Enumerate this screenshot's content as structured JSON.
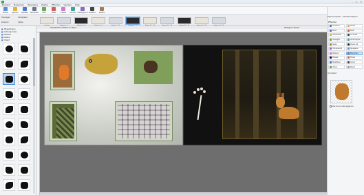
{
  "window": {
    "title": "",
    "controls": [
      "–",
      "□",
      "✕"
    ]
  },
  "menu": [
    "Bestand",
    "Bewerken",
    "Weergave",
    "Pagina",
    "Effecten",
    "Venster",
    "Help"
  ],
  "ribbon": {
    "buttons": [
      {
        "label": "Nieuw",
        "icon": "new-doc-icon",
        "color": "#5b8fd6"
      },
      {
        "label": "Openen",
        "icon": "folder-icon",
        "color": "#e3b341"
      },
      {
        "label": "Opslaan",
        "icon": "save-icon",
        "color": "#4a79c9"
      },
      {
        "label": "Afdrukken",
        "icon": "printer-icon",
        "color": "#6b7683"
      },
      {
        "label": "Foto",
        "icon": "photo-icon",
        "color": "#6aa84f"
      },
      {
        "label": "Tekst",
        "icon": "text-icon",
        "color": "#d05b5b"
      },
      {
        "label": "Clipart",
        "icon": "clipart-icon",
        "color": "#cb7bd2"
      },
      {
        "label": "Vormen",
        "icon": "shapes-icon",
        "color": "#3aa6a0"
      },
      {
        "label": "Achtergrond",
        "icon": "background-icon",
        "color": "#8a6bc9"
      },
      {
        "label": "Maskers",
        "icon": "mask-icon",
        "color": "#444"
      },
      {
        "label": "Kaders",
        "icon": "frame-icon",
        "color": "#a67c52"
      }
    ],
    "right_label": "Album opslaan",
    "right_icon": "export-icon"
  },
  "page_strip": {
    "nav": [
      "Toevoegen",
      "Verwijderen",
      "Kopiëren",
      "Opties"
    ],
    "pages": [
      {
        "label": "Omslag"
      },
      {
        "label": "Pagina 1 - 2"
      },
      {
        "label": "Pagina 3 - 4"
      },
      {
        "label": "Pagina 5 - 6"
      },
      {
        "label": "Pagina 7 - 8"
      },
      {
        "label": "Pagina 9 - 10",
        "selected": true
      },
      {
        "label": "Pagina 11 - 12"
      },
      {
        "label": "Pagina 13 - 14"
      },
      {
        "label": "Pagina 15 - 16"
      },
      {
        "label": "Pagina 17 - 18"
      },
      {
        "label": "Pagina 19 - 20"
      }
    ]
  },
  "left_panel": {
    "tabs": [
      {
        "label": "Afbeeldingen",
        "icon": "image-icon"
      },
      {
        "label": "Achtergronden",
        "icon": "background-icon"
      },
      {
        "label": "Maskers",
        "icon": "mask-icon"
      },
      {
        "label": "Kaders",
        "icon": "frame-icon"
      },
      {
        "label": "Clipart",
        "icon": "clipart-icon"
      }
    ],
    "mask_count": 20,
    "selected_mask": 4
  },
  "editor": {
    "toolbar_label": "Geselecteerd: Masker en object",
    "zoom_label": "Weergave: Spread"
  },
  "right_panel": {
    "tabs": [
      "Eigenschappen",
      "Gereedschappen"
    ],
    "title": "Effecten",
    "items": [
      {
        "label": "Schaduw",
        "icon_color": "#6b7683"
      },
      {
        "label": "Gloed",
        "icon_color": "#e0b23a"
      },
      {
        "label": "Rand",
        "icon_color": "#4a79c9"
      },
      {
        "label": "Kleur",
        "icon_color": "#d05b5b"
      },
      {
        "label": "Helderheid",
        "icon_color": "#e3b341"
      },
      {
        "label": "Contrast",
        "icon_color": "#444"
      },
      {
        "label": "Vervagen",
        "icon_color": "#6aa84f"
      },
      {
        "label": "Verscherpen",
        "icon_color": "#3aa6a0"
      },
      {
        "label": "Sepia",
        "icon_color": "#a67c52"
      },
      {
        "label": "Zwart-wit",
        "icon_color": "#222"
      },
      {
        "label": "Transparant",
        "icon_color": "#8a6bc9"
      },
      {
        "label": "Spiegelen",
        "icon_color": "#5b8fd6"
      },
      {
        "label": "Roteren",
        "icon_color": "#cb7bd2"
      },
      {
        "label": "Bijsnijden",
        "icon_color": "#6b7683",
        "selected": true
      },
      {
        "label": "Masker",
        "icon_color": "#111"
      },
      {
        "label": "Filters",
        "icon_color": "#d05b5b"
      },
      {
        "label": "Tekstkleur",
        "icon_color": "#4a79c9"
      },
      {
        "label": "Lijnen",
        "icon_color": "#444"
      },
      {
        "label": "Vullen",
        "icon_color": "#6aa84f"
      },
      {
        "label": "Reset",
        "icon_color": "#999"
      }
    ],
    "section_label": "Voorbeeld",
    "checkbox_label": "Pas toe op alle pagina's"
  }
}
